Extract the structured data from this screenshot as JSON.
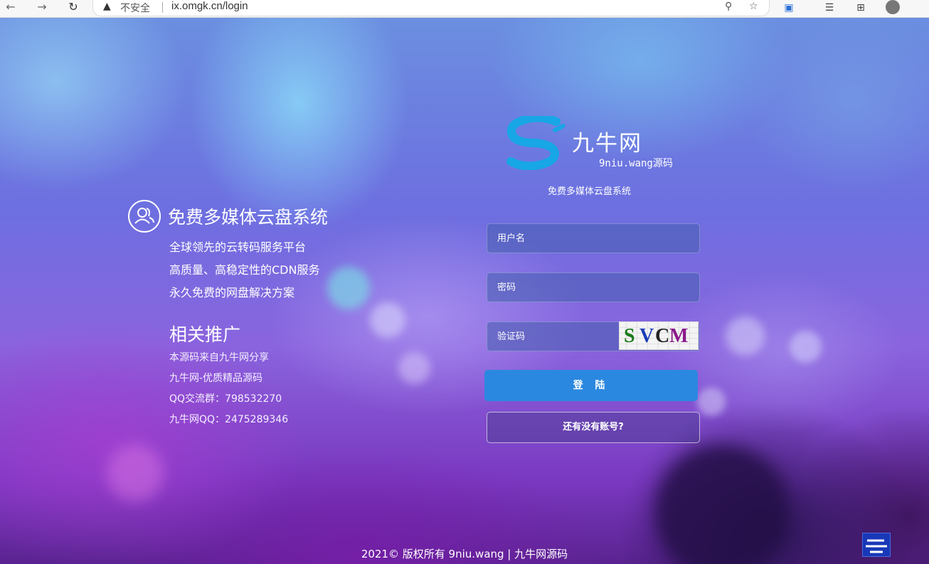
{
  "browser": {
    "back_icon": "arrow-left-icon",
    "forward_icon": "arrow-right-icon",
    "reload_icon": "reload-icon",
    "security_label": "不安全",
    "url": "ix.omgk.cn/login"
  },
  "sidebar_info": {
    "title": "免费多媒体云盘系统",
    "features": [
      "全球领先的云转码服务平台",
      "高质量、高稳定性的CDN服务",
      "永久免费的网盘解决方案"
    ],
    "promo_title": "相关推广",
    "promo_items": [
      "本源码来自九牛网分享",
      "九牛网-优质精品源码",
      "QQ交流群：798532270",
      "九牛网QQ：2475289346"
    ]
  },
  "logo": {
    "name": "九牛网",
    "sub": "9niu.wang源码",
    "subtitle": "免费多媒体云盘系统"
  },
  "form": {
    "username_placeholder": "用户名",
    "password_placeholder": "密码",
    "captcha_placeholder": "验证码",
    "captcha_text": [
      "S",
      "V",
      "C",
      "M"
    ],
    "captcha_colors": [
      "#1a7a1a",
      "#1a3bb8",
      "#222222",
      "#8a1a8a"
    ],
    "login_label": "登 陆",
    "register_label": "还有没有账号?"
  },
  "footer": {
    "text": "2021© 版权所有 9niu.wang | 九牛网源码"
  },
  "colors": {
    "login_button": "#2b88e0",
    "logo_blue": "#17a6e6"
  }
}
